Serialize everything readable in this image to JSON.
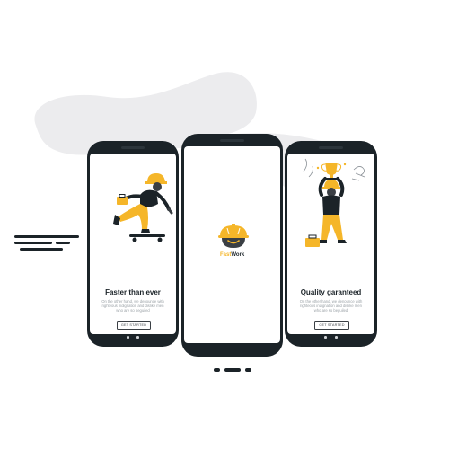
{
  "colors": {
    "accent": "#f5b629",
    "dark": "#1b2328",
    "blob": "#ececee",
    "muted": "#9aa1a6"
  },
  "screens": {
    "left": {
      "title": "Faster than ever",
      "description": [
        "On the other hand, we denounce with",
        "righteous indignation and dislike men",
        "who are so beguiled"
      ],
      "button": "GET STARTED",
      "active_page": 2,
      "page_count": 3
    },
    "center": {
      "brand_part1": "Fast",
      "brand_part2": "Work",
      "logo_icon": "hard-hat-icon"
    },
    "right": {
      "title": "Quality garanteed",
      "description": [
        "On the other hand, we denounce with",
        "righteous indignation and dislike men",
        "who are so beguiled"
      ],
      "button": "GET STARTED",
      "active_page": 3,
      "page_count": 3
    }
  }
}
